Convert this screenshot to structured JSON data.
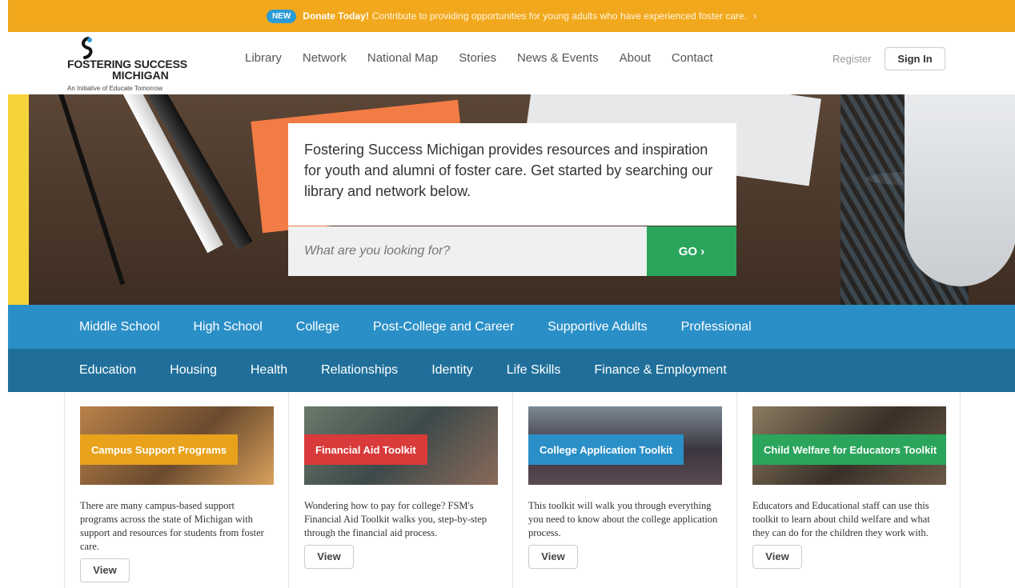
{
  "banner": {
    "badge": "NEW",
    "strong": "Donate Today!",
    "text": "Contribute to providing opportunities for young adults who have experienced foster care.",
    "chevron": "›"
  },
  "logo": {
    "line1": "FOSTERING SUCCESS",
    "line2": "MICHIGAN",
    "tagline": "An Initiative of Educate Tomorrow"
  },
  "nav": [
    "Library",
    "Network",
    "National Map",
    "Stories",
    "News & Events",
    "About",
    "Contact"
  ],
  "auth": {
    "register": "Register",
    "signin": "Sign In"
  },
  "hero": {
    "text": "Fostering Success Michigan provides resources and inspiration for youth and alumni of foster care. Get started by searching our library and network below.",
    "placeholder": "What are you looking for?",
    "go": "GO ›"
  },
  "audiences": [
    "Middle School",
    "High School",
    "College",
    "Post-College and Career",
    "Supportive Adults",
    "Professional"
  ],
  "topics": [
    "Education",
    "Housing",
    "Health",
    "Relationships",
    "Identity",
    "Life Skills",
    "Finance & Employment"
  ],
  "cards": [
    {
      "label": "Campus Support Programs",
      "color": "#e8a21b",
      "text": "There are many campus-based support programs across the state of Michigan with support and resources for students from foster care.",
      "button": "View"
    },
    {
      "label": "Financial Aid Toolkit",
      "color": "#d93a3a",
      "text": "Wondering how to pay for college? FSM's Financial Aid Toolkit walks you, step-by-step through the financial aid process.",
      "button": "View"
    },
    {
      "label": "College Application Toolkit",
      "color": "#2b8fc7",
      "text": "This toolkit will walk you through everything you need to know about the college application process.",
      "button": "View"
    },
    {
      "label": "Child Welfare for Educators Toolkit",
      "color": "#2aa55b",
      "text": "Educators and Educational staff can use this toolkit to learn about child welfare and what they can do for the children they work with.",
      "button": "View"
    }
  ]
}
